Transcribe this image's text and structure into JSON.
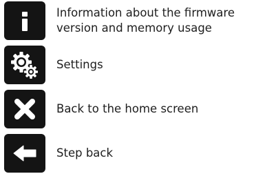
{
  "legend": {
    "items": [
      {
        "icon": "info-icon",
        "label": "Information about the firmware\nversion and memory usage"
      },
      {
        "icon": "gears-icon",
        "label": "Settings"
      },
      {
        "icon": "close-x-icon",
        "label": "Back to the home screen"
      },
      {
        "icon": "arrow-left-icon",
        "label": "Step back"
      }
    ]
  },
  "colors": {
    "button_background": "#141414",
    "icon_foreground": "#ffffff",
    "text": "#1e1e1e",
    "page_background": "#ffffff"
  }
}
